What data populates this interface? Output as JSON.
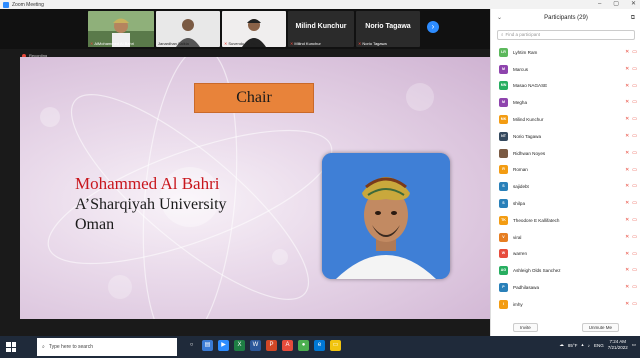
{
  "window": {
    "title": "Zoom Meeting"
  },
  "gallery": {
    "thumbs": [
      {
        "name": "AlMohammed Al Bahri"
      },
      {
        "name": "Janardhan Saikia"
      },
      {
        "name": "Suvendu DISSD"
      },
      {
        "name": "Milind Kunchur",
        "big": "Milind Kunchur"
      },
      {
        "name": "Norio Tagawa",
        "big": "Norio Tagawa"
      }
    ],
    "recording": "Recording"
  },
  "slide": {
    "chair": "Chair",
    "speaker_name": "Mohammed Al Bahri",
    "university": "A’Sharqiyah University",
    "country": "Oman"
  },
  "panel": {
    "title": "Participants (29)",
    "search_placeholder": "Find a participant",
    "participants": [
      {
        "initials": "LR",
        "name": "Lyhtim Ram",
        "color": "#5cb85c"
      },
      {
        "initials": "M",
        "name": "Marcus",
        "color": "#8e44ad"
      },
      {
        "initials": "MN",
        "name": "Masao NAGASE",
        "color": "#27ae60"
      },
      {
        "initials": "M",
        "name": "Megha",
        "color": "#8e44ad"
      },
      {
        "initials": "MK",
        "name": "Milind Kunchur",
        "color": "#f39c12"
      },
      {
        "initials": "NT",
        "name": "Norio Tagawa",
        "color": "#34495e"
      },
      {
        "initials": "",
        "name": "Ridhwan Noyes",
        "color": "#7a5a43"
      },
      {
        "initials": "R",
        "name": "Roman",
        "color": "#f39c12"
      },
      {
        "initials": "S",
        "name": "sajidebt",
        "color": "#2980b9"
      },
      {
        "initials": "S",
        "name": "shilpa",
        "color": "#2980b9"
      },
      {
        "initials": "TK",
        "name": "Theodore E Kallifatech",
        "color": "#f39c12"
      },
      {
        "initials": "V",
        "name": "viral",
        "color": "#e67e22"
      },
      {
        "initials": "W",
        "name": "warren",
        "color": "#e74c3c"
      },
      {
        "initials": "AG",
        "name": "Ashleigh Olds Sanchez",
        "color": "#27ae60"
      },
      {
        "initials": "P",
        "name": "Padhilasawa",
        "color": "#2980b9"
      },
      {
        "initials": "I",
        "name": "imhy",
        "color": "#f39c12"
      }
    ],
    "invite": "Invite",
    "unmute_me": "Unmute Me"
  },
  "taskbar": {
    "search_placeholder": "Type here to search",
    "weather": "85°F",
    "lang": "ENG",
    "time": "7:24 AM",
    "date": "7/21/2022"
  }
}
